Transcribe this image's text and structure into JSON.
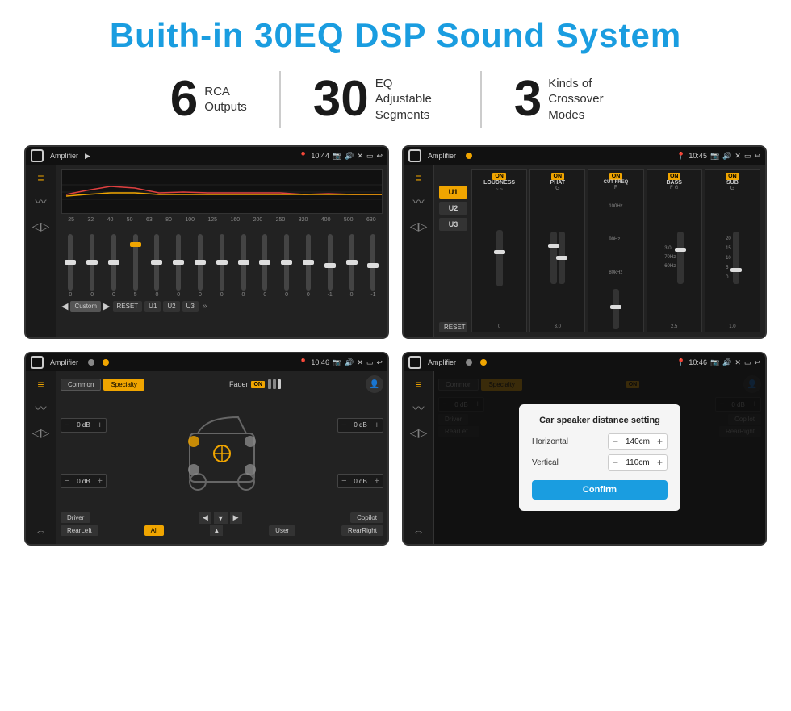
{
  "title": "Buith-in 30EQ DSP Sound System",
  "stats": [
    {
      "number": "6",
      "label": "RCA\nOutputs"
    },
    {
      "number": "30",
      "label": "EQ Adjustable\nSegments"
    },
    {
      "number": "3",
      "label": "Kinds of\nCrossover Modes"
    }
  ],
  "screens": {
    "eq_screen": {
      "app_name": "Amplifier",
      "time": "10:44",
      "eq_freqs": [
        "25",
        "32",
        "40",
        "50",
        "63",
        "80",
        "100",
        "125",
        "160",
        "200",
        "250",
        "320",
        "400",
        "500",
        "630"
      ],
      "eq_values": [
        "0",
        "0",
        "0",
        "5",
        "0",
        "0",
        "0",
        "0",
        "0",
        "0",
        "0",
        "0",
        "-1",
        "0",
        "-1"
      ],
      "bottom_btns": [
        "Custom",
        "RESET",
        "U1",
        "U2",
        "U3"
      ]
    },
    "crossover_screen": {
      "app_name": "Amplifier",
      "time": "10:45",
      "u_buttons": [
        "U1",
        "U2",
        "U3"
      ],
      "channels": [
        {
          "label": "LOUDNESS",
          "on": true
        },
        {
          "label": "PHAT",
          "on": true
        },
        {
          "label": "CUT FREQ",
          "on": true
        },
        {
          "label": "BASS",
          "on": true
        },
        {
          "label": "SUB",
          "on": true
        }
      ],
      "reset_label": "RESET"
    },
    "fader_screen": {
      "app_name": "Amplifier",
      "time": "10:46",
      "tabs": [
        "Common",
        "Specialty"
      ],
      "fader_label": "Fader",
      "on_label": "ON",
      "db_values": [
        "0 dB",
        "0 dB",
        "0 dB",
        "0 dB"
      ],
      "bottom_btns": [
        "Driver",
        "",
        "",
        "",
        "Copilot"
      ],
      "bottom_row": [
        "RearLeft",
        "All",
        "",
        "User",
        "RearRight"
      ]
    },
    "dialog_screen": {
      "app_name": "Amplifier",
      "time": "10:46",
      "tabs": [
        "Common",
        "Specialty"
      ],
      "on_label": "ON",
      "dialog": {
        "title": "Car speaker distance setting",
        "horizontal_label": "Horizontal",
        "horizontal_value": "140cm",
        "vertical_label": "Vertical",
        "vertical_value": "110cm",
        "confirm_label": "Confirm"
      },
      "db_values": [
        "0 dB",
        "0 dB"
      ],
      "bottom_btns": [
        "Driver",
        "",
        "Copilot"
      ],
      "bottom_row2": [
        "RearLef...",
        "",
        "User",
        "RearRight"
      ]
    }
  },
  "colors": {
    "accent": "#1a9de0",
    "orange": "#f0a500",
    "bg_dark": "#1a1a1a",
    "text_light": "#cccccc",
    "title_blue": "#1a9de0"
  }
}
